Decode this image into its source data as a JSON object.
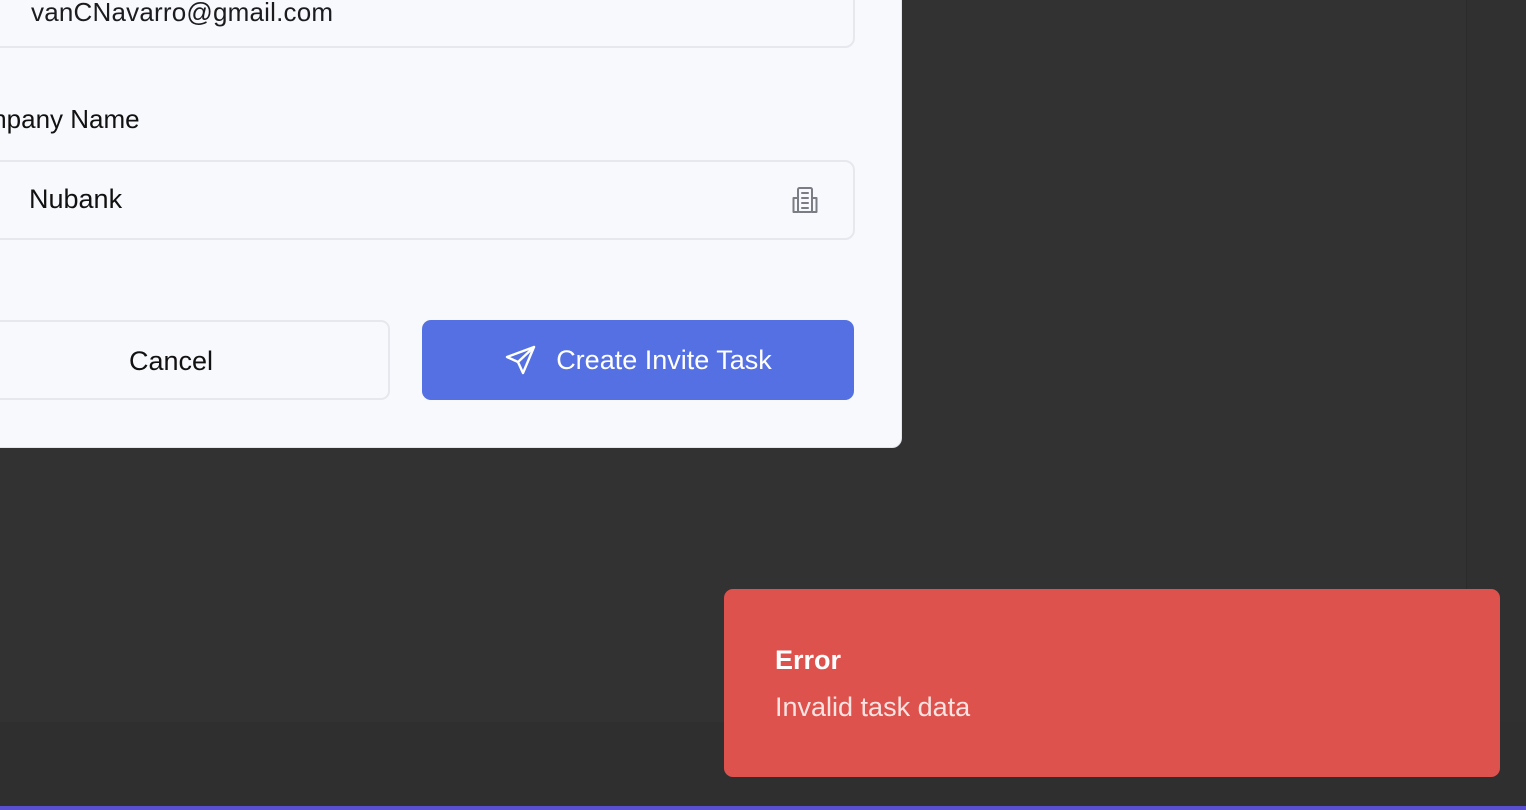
{
  "form": {
    "email_value": "vanCNavarro@gmail.com",
    "company_label": "mpany Name",
    "company_value": "Nubank",
    "company_icon": "building-icon"
  },
  "actions": {
    "cancel_label": "Cancel",
    "create_label": "Create Invite Task",
    "create_icon": "send-icon"
  },
  "toast": {
    "title": "Error",
    "message": "Invalid task data",
    "color": "#de524d"
  },
  "colors": {
    "primary": "#5470e2",
    "backdrop": "#323232",
    "modal_bg": "#f8f9fd"
  }
}
